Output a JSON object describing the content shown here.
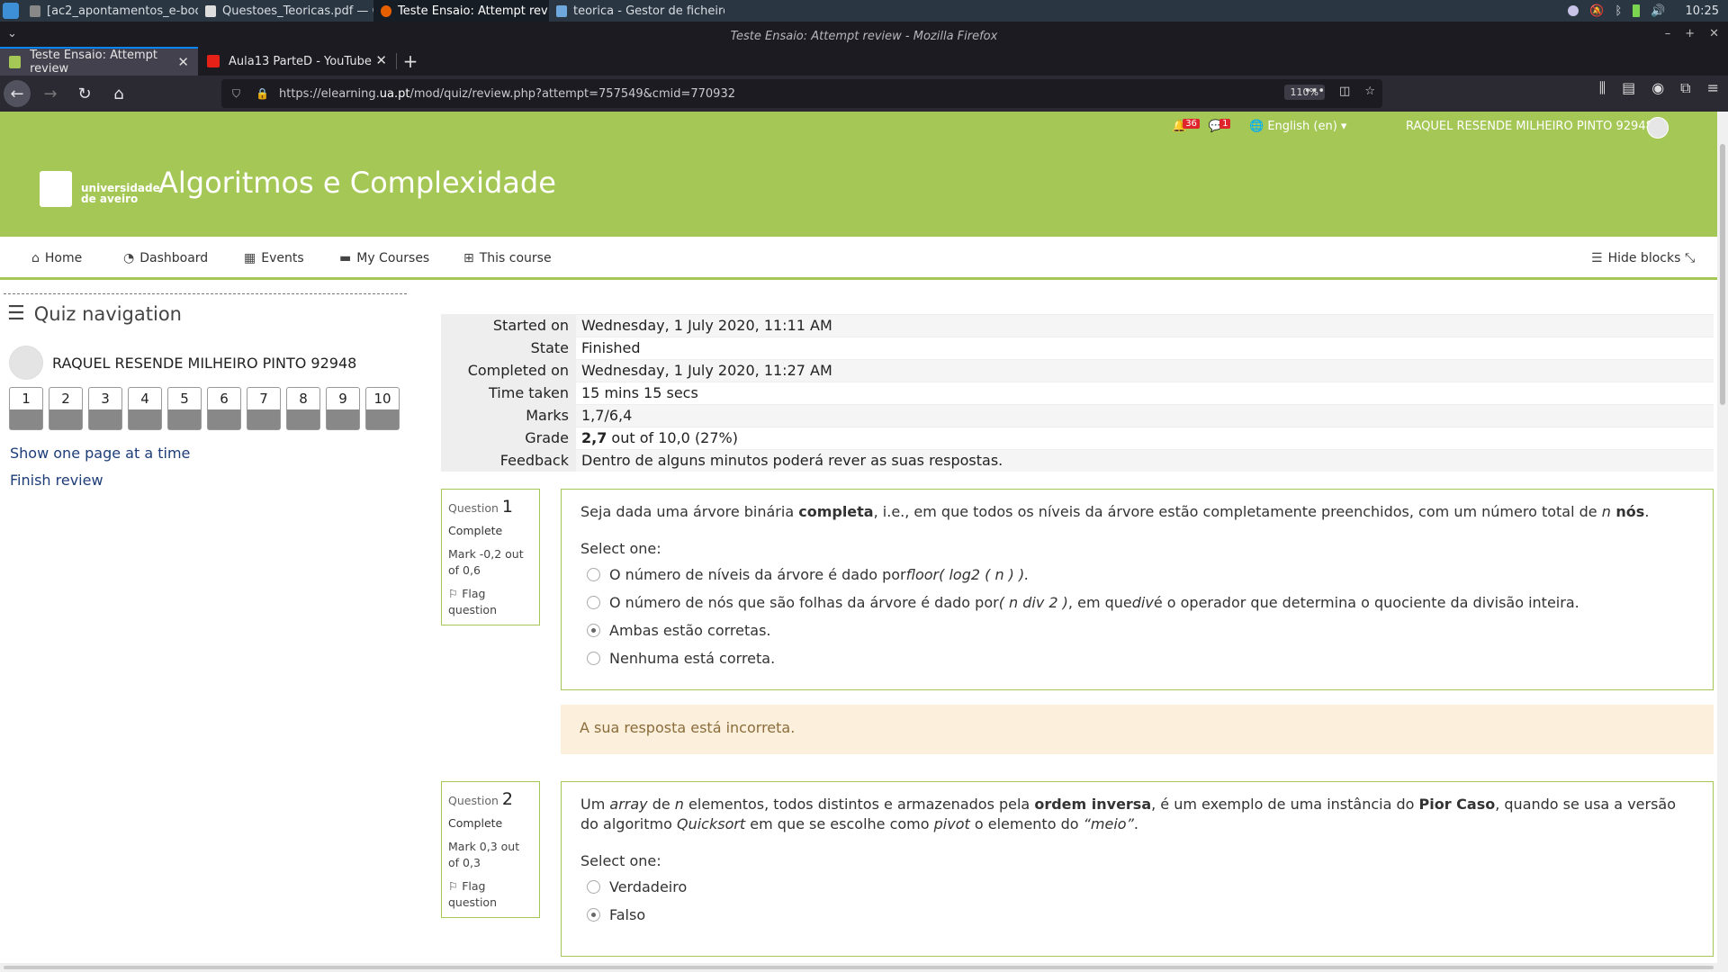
{
  "os_taskbar": {
    "tasks": [
      {
        "label": "[ac2_apontamentos_e-book..."
      },
      {
        "label": "Questoes_Teoricas.pdf — Q..."
      },
      {
        "label": "Teste Ensaio: Attempt revie..."
      },
      {
        "label": "teorica - Gestor de ficheiros"
      }
    ],
    "clock": "10:25"
  },
  "window": {
    "title": "Teste Ensaio: Attempt review - Mozilla Firefox"
  },
  "browser": {
    "tabs": [
      {
        "label": "Teste Ensaio: Attempt review"
      },
      {
        "label": "Aula13 ParteD - YouTube"
      }
    ],
    "url_prefix": "https://elearning.",
    "url_domain": "ua.pt",
    "url_path": "/mod/quiz/review.php?attempt=757549&cmid=770932",
    "zoom": "110%"
  },
  "moodle_header": {
    "notification_count": "36",
    "message_count": "1",
    "language": "English (en)",
    "user_name": "RAQUEL RESENDE MILHEIRO PINTO 92948",
    "logo_line1": "universidade",
    "logo_line2": "de aveiro",
    "course_title": "Algoritmos e Complexidade"
  },
  "course_nav": {
    "home": "Home",
    "dashboard": "Dashboard",
    "events": "Events",
    "my_courses": "My Courses",
    "this_course": "This course",
    "hide_blocks": "Hide blocks"
  },
  "quiz_nav": {
    "title": "Quiz navigation",
    "user_name": "RAQUEL RESENDE MILHEIRO PINTO 92948",
    "buttons": [
      "1",
      "2",
      "3",
      "4",
      "5",
      "6",
      "7",
      "8",
      "9",
      "10"
    ],
    "show_one_page": "Show one page at a time",
    "finish_review": "Finish review"
  },
  "summary": {
    "rows": [
      {
        "label": "Started on",
        "value": "Wednesday, 1 July 2020, 11:11 AM"
      },
      {
        "label": "State",
        "value": "Finished"
      },
      {
        "label": "Completed on",
        "value": "Wednesday, 1 July 2020, 11:27 AM"
      },
      {
        "label": "Time taken",
        "value": "15 mins 15 secs"
      },
      {
        "label": "Marks",
        "value": "1,7/6,4"
      },
      {
        "label": "Grade",
        "value_bold": "2,7",
        "value": " out of 10,0 (27%)"
      },
      {
        "label": "Feedback",
        "value": "Dentro de alguns minutos poderá rever as suas respostas."
      }
    ]
  },
  "questions": [
    {
      "label": "Question",
      "number": "1",
      "state": "Complete",
      "grade": "Mark -0,2 out of 0,6",
      "flag": "Flag question",
      "text_parts": {
        "a": "Seja dada uma árvore binária ",
        "b": "completa",
        "c": ", i.e., em que todos os níveis da árvore estão completamente preenchidos, com um número total de ",
        "d": "n",
        "e": " nós",
        "f": "."
      },
      "prompt": "Select one:",
      "options": [
        {
          "t1": "O número de níveis da árvore é dado por ",
          "i1": "floor( log2 ( n ) ).",
          "t2": "",
          "i2": "",
          "t3": "",
          "checked": false
        },
        {
          "t1": "O número de nós que são folhas da árvore é dado por ",
          "i1": "( n div 2 )",
          "t2": ", em que ",
          "i2": "div",
          "t3": " é o operador que determina o quociente da divisão inteira.",
          "checked": false
        },
        {
          "t1": "Ambas estão corretas.",
          "i1": "",
          "t2": "",
          "i2": "",
          "t3": "",
          "checked": true
        },
        {
          "t1": "Nenhuma está correta.",
          "i1": "",
          "t2": "",
          "i2": "",
          "t3": "",
          "checked": false
        }
      ],
      "feedback": "A sua resposta está incorreta."
    },
    {
      "label": "Question",
      "number": "2",
      "state": "Complete",
      "grade": "Mark 0,3 out of 0,3",
      "flag": "Flag question",
      "text_parts": {
        "a": "Um ",
        "b": "array",
        "c": " de ",
        "d": "n",
        "e": " elementos, todos distintos e armazenados pela ",
        "f": "ordem inversa",
        "g": ", é um exemplo de uma instância do ",
        "h": "Pior Caso",
        "i": ", quando se usa a versão do algoritmo ",
        "j": "Quicksort",
        "k": " em que se escolhe como ",
        "l": "pivot",
        "m": " o elemento do ",
        "n": "“meio”",
        "o": "."
      },
      "prompt": "Select one:",
      "options": [
        {
          "label": "Verdadeiro",
          "checked": false
        },
        {
          "label": "Falso",
          "checked": true
        }
      ]
    }
  ],
  "colors": {
    "moodle_green": "#a5c756",
    "link_blue": "#1d3d78",
    "feedback_bg": "#fcefdc"
  }
}
